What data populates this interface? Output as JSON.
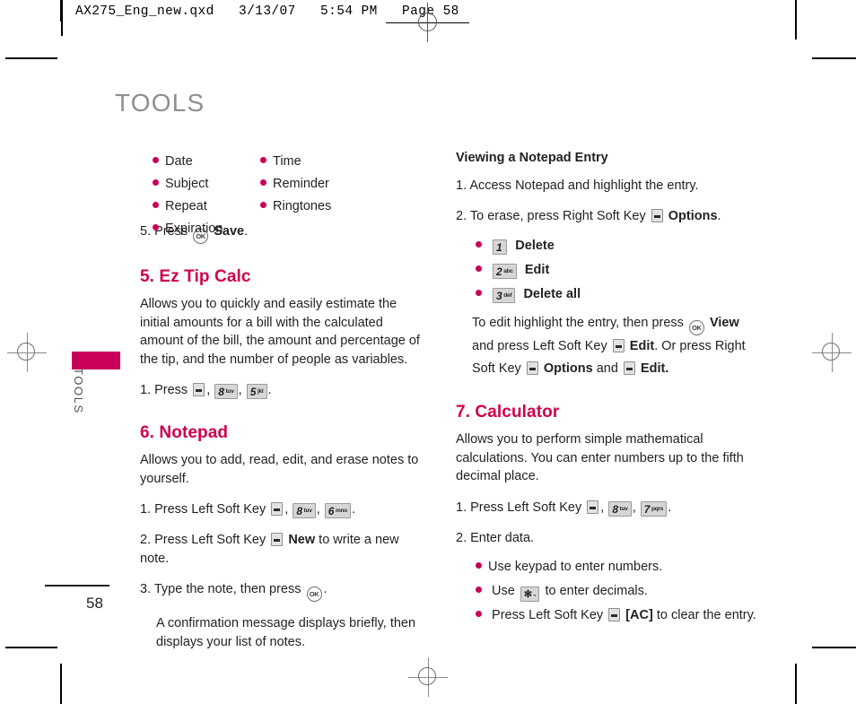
{
  "print_header": {
    "text": "AX275_Eng_new.qxd   3/13/07   5:54 PM   Page 58"
  },
  "page": {
    "title": "TOOLS",
    "side_tab_label": "TOOLS",
    "number": "58"
  },
  "left_column": {
    "feature_bullets_col1": [
      "Date",
      "Subject",
      "Repeat",
      "Expiration"
    ],
    "feature_bullets_col2": [
      "Time",
      "Reminder",
      "Ringtones"
    ],
    "save_step": {
      "prefix": "5. Press",
      "ok_label": "OK",
      "bold_text": "Save",
      "suffix": "."
    },
    "ez_tip_calc": {
      "heading": "5. Ez Tip Calc",
      "body": "Allows you to quickly and easily estimate the initial amounts for a bill with the calculated amount of the bill, the amount and percentage of the tip, and the number of people as variables.",
      "step_prefix": "1. Press",
      "keys": [
        {
          "num": "8",
          "sub": "tuv"
        },
        {
          "num": "5",
          "sub": "jkl"
        }
      ],
      "step_suffix": "."
    },
    "notepad": {
      "heading": "6. Notepad",
      "body": "Allows you to add, read, edit, and erase notes to yourself.",
      "step1_prefix": "1. Press Left Soft Key",
      "step1_keys": [
        {
          "num": "8",
          "sub": "tuv"
        },
        {
          "num": "6",
          "sub": "mno"
        }
      ],
      "step1_suffix": ".",
      "step2_prefix": "2. Press Left Soft Key",
      "step2_bold": "New",
      "step2_suffix": "to write a new note.",
      "step3_prefix": "3. Type the note, then press",
      "step3_ok": "OK",
      "step3_suffix": ".",
      "step3_note": "A confirmation message displays briefly, then displays your list of notes."
    }
  },
  "right_column": {
    "viewing_entry": {
      "heading": "Viewing a Notepad Entry",
      "step1": "1. Access Notepad and highlight the entry.",
      "step2_prefix": "2. To erase, press Right Soft Key",
      "step2_bold": "Options",
      "step2_suffix": ".",
      "options": [
        {
          "key": {
            "num": "1",
            "sub": ""
          },
          "label": "Delete"
        },
        {
          "key": {
            "num": "2",
            "sub": "abc"
          },
          "label": "Edit"
        },
        {
          "key": {
            "num": "3",
            "sub": "def"
          },
          "label": "Delete all"
        }
      ],
      "edit_note_p1": "To edit highlight the entry, then press",
      "edit_note_ok": "OK",
      "edit_note_b1": "View",
      "edit_note_p2": "and press Left Soft Key",
      "edit_note_b2": "Edit",
      "edit_note_p3": ". Or press Right Soft Key",
      "edit_note_b3": "Options",
      "edit_note_p4": "and",
      "edit_note_b4": "Edit."
    },
    "calculator": {
      "heading": "7. Calculator",
      "body": "Allows you to perform simple mathematical calculations. You can enter numbers up to the fifth decimal place.",
      "step1_prefix": "1. Press Left Soft Key",
      "step1_keys": [
        {
          "num": "8",
          "sub": "tuv"
        },
        {
          "num": "7",
          "sub": "pqrs"
        }
      ],
      "step1_suffix": ".",
      "step2": "2. Enter data.",
      "bullets": {
        "b1": "Use keypad to enter numbers.",
        "b2_prefix": "Use",
        "b2_key": {
          "num": "✻",
          "sub": ""
        },
        "b2_suffix": "to enter decimals.",
        "b3_prefix": "Press Left Soft Key",
        "b3_bold": "[AC]",
        "b3_suffix": "to clear the entry."
      }
    }
  },
  "colors": {
    "accent": "#c8005a",
    "heading_pink": "#d0004b",
    "title_gray": "#8e8e8e",
    "text": "#231f20"
  }
}
